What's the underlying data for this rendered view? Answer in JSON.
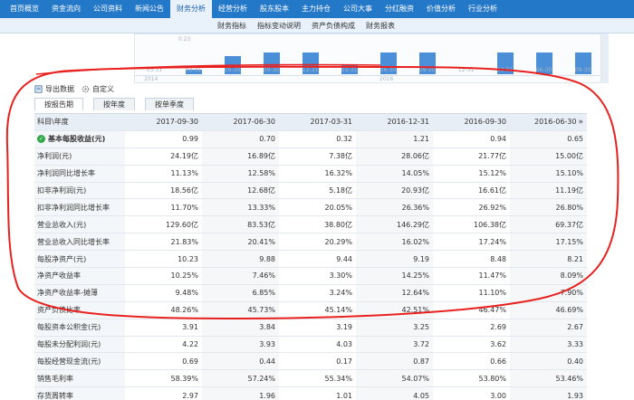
{
  "topnav": {
    "items": [
      "首页概览",
      "资金流向",
      "公司资料",
      "新闻公告",
      "财务分析",
      "经营分析",
      "股东股本",
      "主力持仓",
      "公司大事",
      "分红融资",
      "价值分析",
      "行业分析"
    ],
    "active_index": 4
  },
  "subnav": {
    "items": [
      "财务指标",
      "指标变动说明",
      "资产负债构成",
      "财务报表"
    ]
  },
  "chart": {
    "value_label": "0.23",
    "x_ticks": [
      "03-31",
      "03-31",
      "06-30",
      "09-30",
      "12-31",
      "03-31",
      "06-30",
      "09-30",
      "12-31",
      "03-01",
      "06-30",
      "09-30"
    ],
    "years": [
      "2014",
      "2016"
    ],
    "bar_levels": [
      0.0,
      0.12,
      0.45,
      0.55,
      0.55,
      0.25,
      0.55,
      0.55,
      0.0,
      0.55,
      0.55,
      0.55
    ]
  },
  "tools": {
    "export_label": "导出数据",
    "custom_label": "自定义"
  },
  "tabs": [
    "按报告期",
    "按年度",
    "按单季度"
  ],
  "table": {
    "header_label": "科目\\年度",
    "periods": [
      "2017-09-30",
      "2017-06-30",
      "2017-03-31",
      "2016-12-31",
      "2016-09-30",
      "2016-06-30"
    ],
    "next_icon": "double-chevron-right",
    "rows": [
      {
        "label": "基本每股收益(元)",
        "values": [
          "0.99",
          "0.70",
          "0.32",
          "1.21",
          "0.94",
          "0.65"
        ],
        "checked": true
      },
      {
        "label": "净利润(元)",
        "values": [
          "24.19亿",
          "16.89亿",
          "7.38亿",
          "28.06亿",
          "21.77亿",
          "15.00亿"
        ]
      },
      {
        "label": "净利润同比增长率",
        "values": [
          "11.13%",
          "12.58%",
          "16.32%",
          "14.05%",
          "15.12%",
          "15.10%"
        ]
      },
      {
        "label": "扣非净利润(元)",
        "values": [
          "18.56亿",
          "12.68亿",
          "5.18亿",
          "20.93亿",
          "16.61亿",
          "11.19亿"
        ]
      },
      {
        "label": "扣非净利润同比增长率",
        "values": [
          "11.70%",
          "13.33%",
          "20.05%",
          "26.36%",
          "26.92%",
          "26.80%"
        ]
      },
      {
        "label": "营业总收入(元)",
        "values": [
          "129.60亿",
          "83.53亿",
          "38.80亿",
          "146.29亿",
          "106.38亿",
          "69.37亿"
        ]
      },
      {
        "label": "营业总收入同比增长率",
        "values": [
          "21.83%",
          "20.41%",
          "20.29%",
          "16.02%",
          "17.24%",
          "17.15%"
        ]
      },
      {
        "label": "每股净资产(元)",
        "values": [
          "10.23",
          "9.88",
          "9.44",
          "9.19",
          "8.48",
          "8.21"
        ]
      },
      {
        "label": "净资产收益率",
        "values": [
          "10.25%",
          "7.46%",
          "3.30%",
          "14.25%",
          "11.47%",
          "8.09%"
        ]
      },
      {
        "label": "净资产收益率-摊薄",
        "values": [
          "9.48%",
          "6.85%",
          "3.24%",
          "12.64%",
          "11.10%",
          "7.90%"
        ]
      },
      {
        "label": "资产负债比率",
        "values": [
          "48.26%",
          "45.73%",
          "45.14%",
          "42.51%",
          "46.47%",
          "46.69%"
        ]
      },
      {
        "label": "每股资本公积金(元)",
        "values": [
          "3.91",
          "3.84",
          "3.19",
          "3.25",
          "2.69",
          "2.67"
        ]
      },
      {
        "label": "每股未分配利润(元)",
        "values": [
          "4.22",
          "3.93",
          "4.03",
          "3.72",
          "3.62",
          "3.33"
        ]
      },
      {
        "label": "每股经营现金流(元)",
        "values": [
          "0.69",
          "0.44",
          "0.17",
          "0.87",
          "0.66",
          "0.40"
        ]
      },
      {
        "label": "销售毛利率",
        "values": [
          "58.39%",
          "57.24%",
          "55.34%",
          "54.07%",
          "53.80%",
          "53.46%"
        ]
      },
      {
        "label": "存货周转率",
        "values": [
          "2.97",
          "1.96",
          "1.01",
          "4.05",
          "3.00",
          "1.93"
        ]
      }
    ]
  },
  "colors": {
    "nav_blue": "#2478c8",
    "sub_bg": "#e9f1fb",
    "annotation_red": "#e8211f",
    "check_green": "#32a84b"
  }
}
